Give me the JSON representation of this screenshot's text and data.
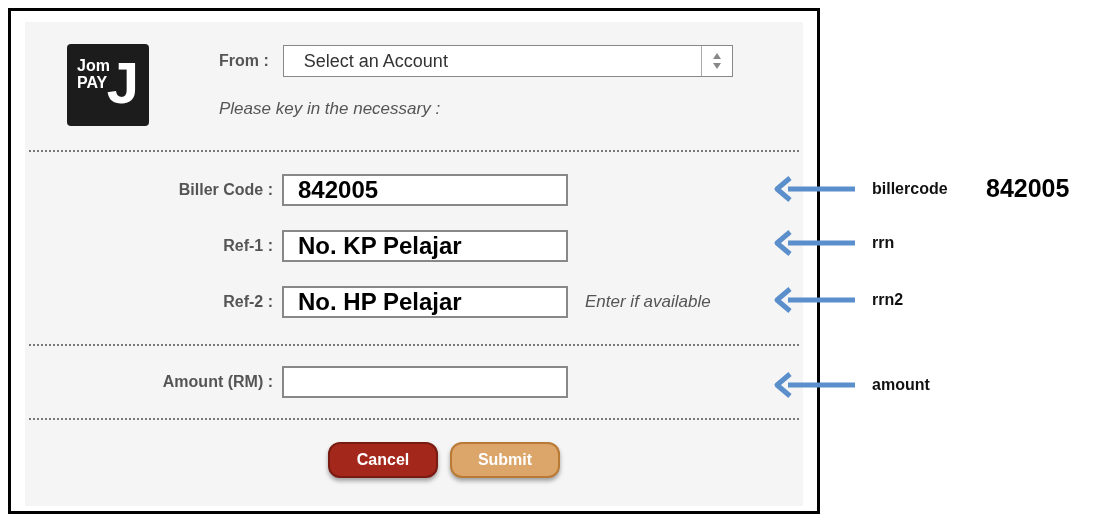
{
  "logo": {
    "line_1": "Jom",
    "line_2": "PAY",
    "letter": "J"
  },
  "account": {
    "label": "From :",
    "value": "Select an Account"
  },
  "instruction": "Please key in the necessary :",
  "reference_fields": [
    {
      "label": "Biller Code :",
      "value": "842005"
    },
    {
      "label": "Ref-1 :",
      "value": "No. KP Pelajar"
    },
    {
      "label": "Ref-2 :",
      "value": "No. HP Pelajar",
      "hint": "Enter if available"
    }
  ],
  "amount_field": {
    "label": "Amount (RM) :"
  },
  "buttons": [
    {
      "label": "Cancel",
      "kind": "cancel"
    },
    {
      "label": "Submit",
      "kind": "submit"
    }
  ],
  "annotations": [
    {
      "label": "billercode",
      "value": "842005"
    },
    {
      "label": "rrn"
    },
    {
      "label": "rrn2"
    },
    {
      "label": "amount"
    }
  ]
}
